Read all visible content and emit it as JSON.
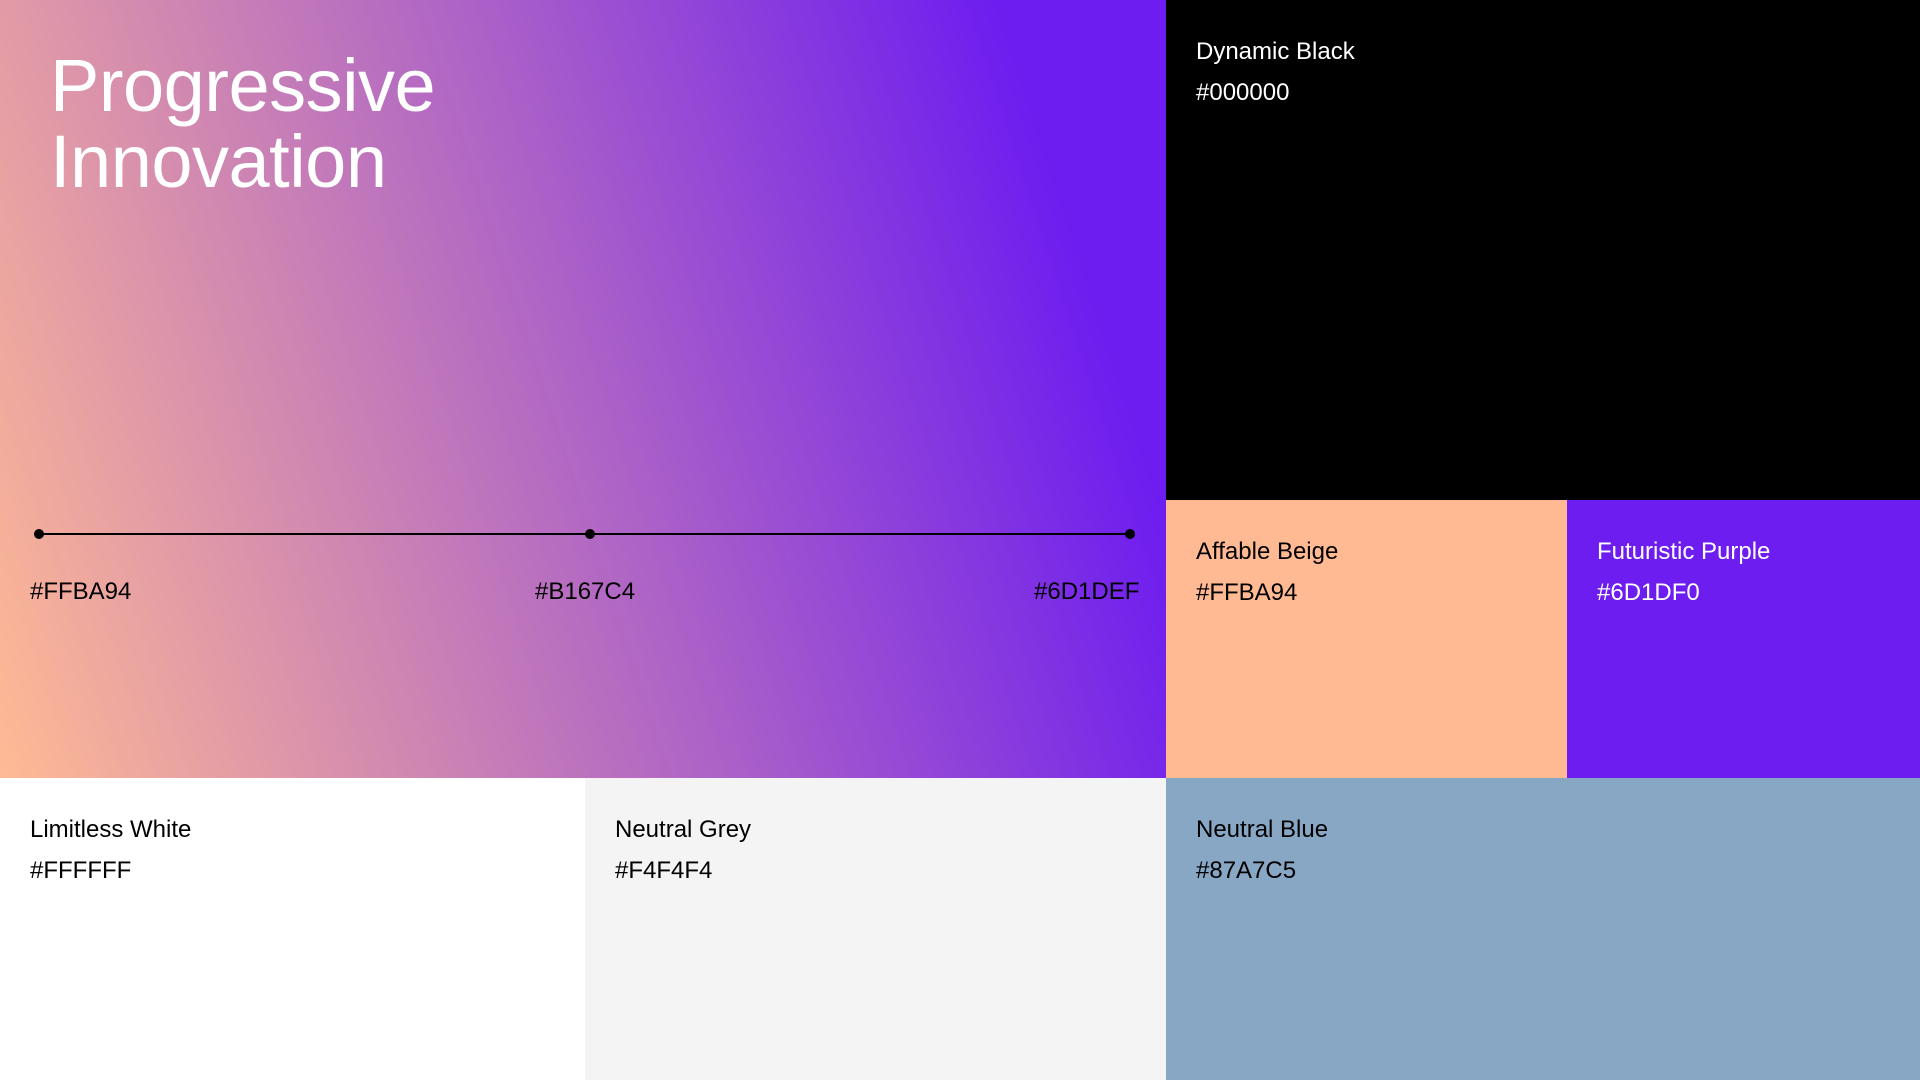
{
  "hero": {
    "title": "Progressive\nInnovation",
    "gradient_stops": [
      {
        "label": "#FFBA94",
        "color": "#FFBA94"
      },
      {
        "label": "#B167C4",
        "color": "#B167C4"
      },
      {
        "label": "#6D1DEF",
        "color": "#6D1DEF"
      }
    ]
  },
  "swatches": {
    "dynamic_black": {
      "name": "Dynamic Black",
      "hex": "#000000",
      "color": "#000000"
    },
    "affable_beige": {
      "name": "Affable Beige",
      "hex": "#FFBA94",
      "color": "#FFBA94"
    },
    "futuristic_purple": {
      "name": "Futuristic Purple",
      "hex": "#6D1DF0",
      "color": "#6D1DF0"
    },
    "limitless_white": {
      "name": "Limitless White",
      "hex": "#FFFFFF",
      "color": "#FFFFFF"
    },
    "neutral_grey": {
      "name": "Neutral Grey",
      "hex": "#F4F4F4",
      "color": "#F4F4F4"
    },
    "neutral_blue": {
      "name": "Neutral Blue",
      "hex": "#87A7C5",
      "color": "#87A7C5"
    }
  }
}
